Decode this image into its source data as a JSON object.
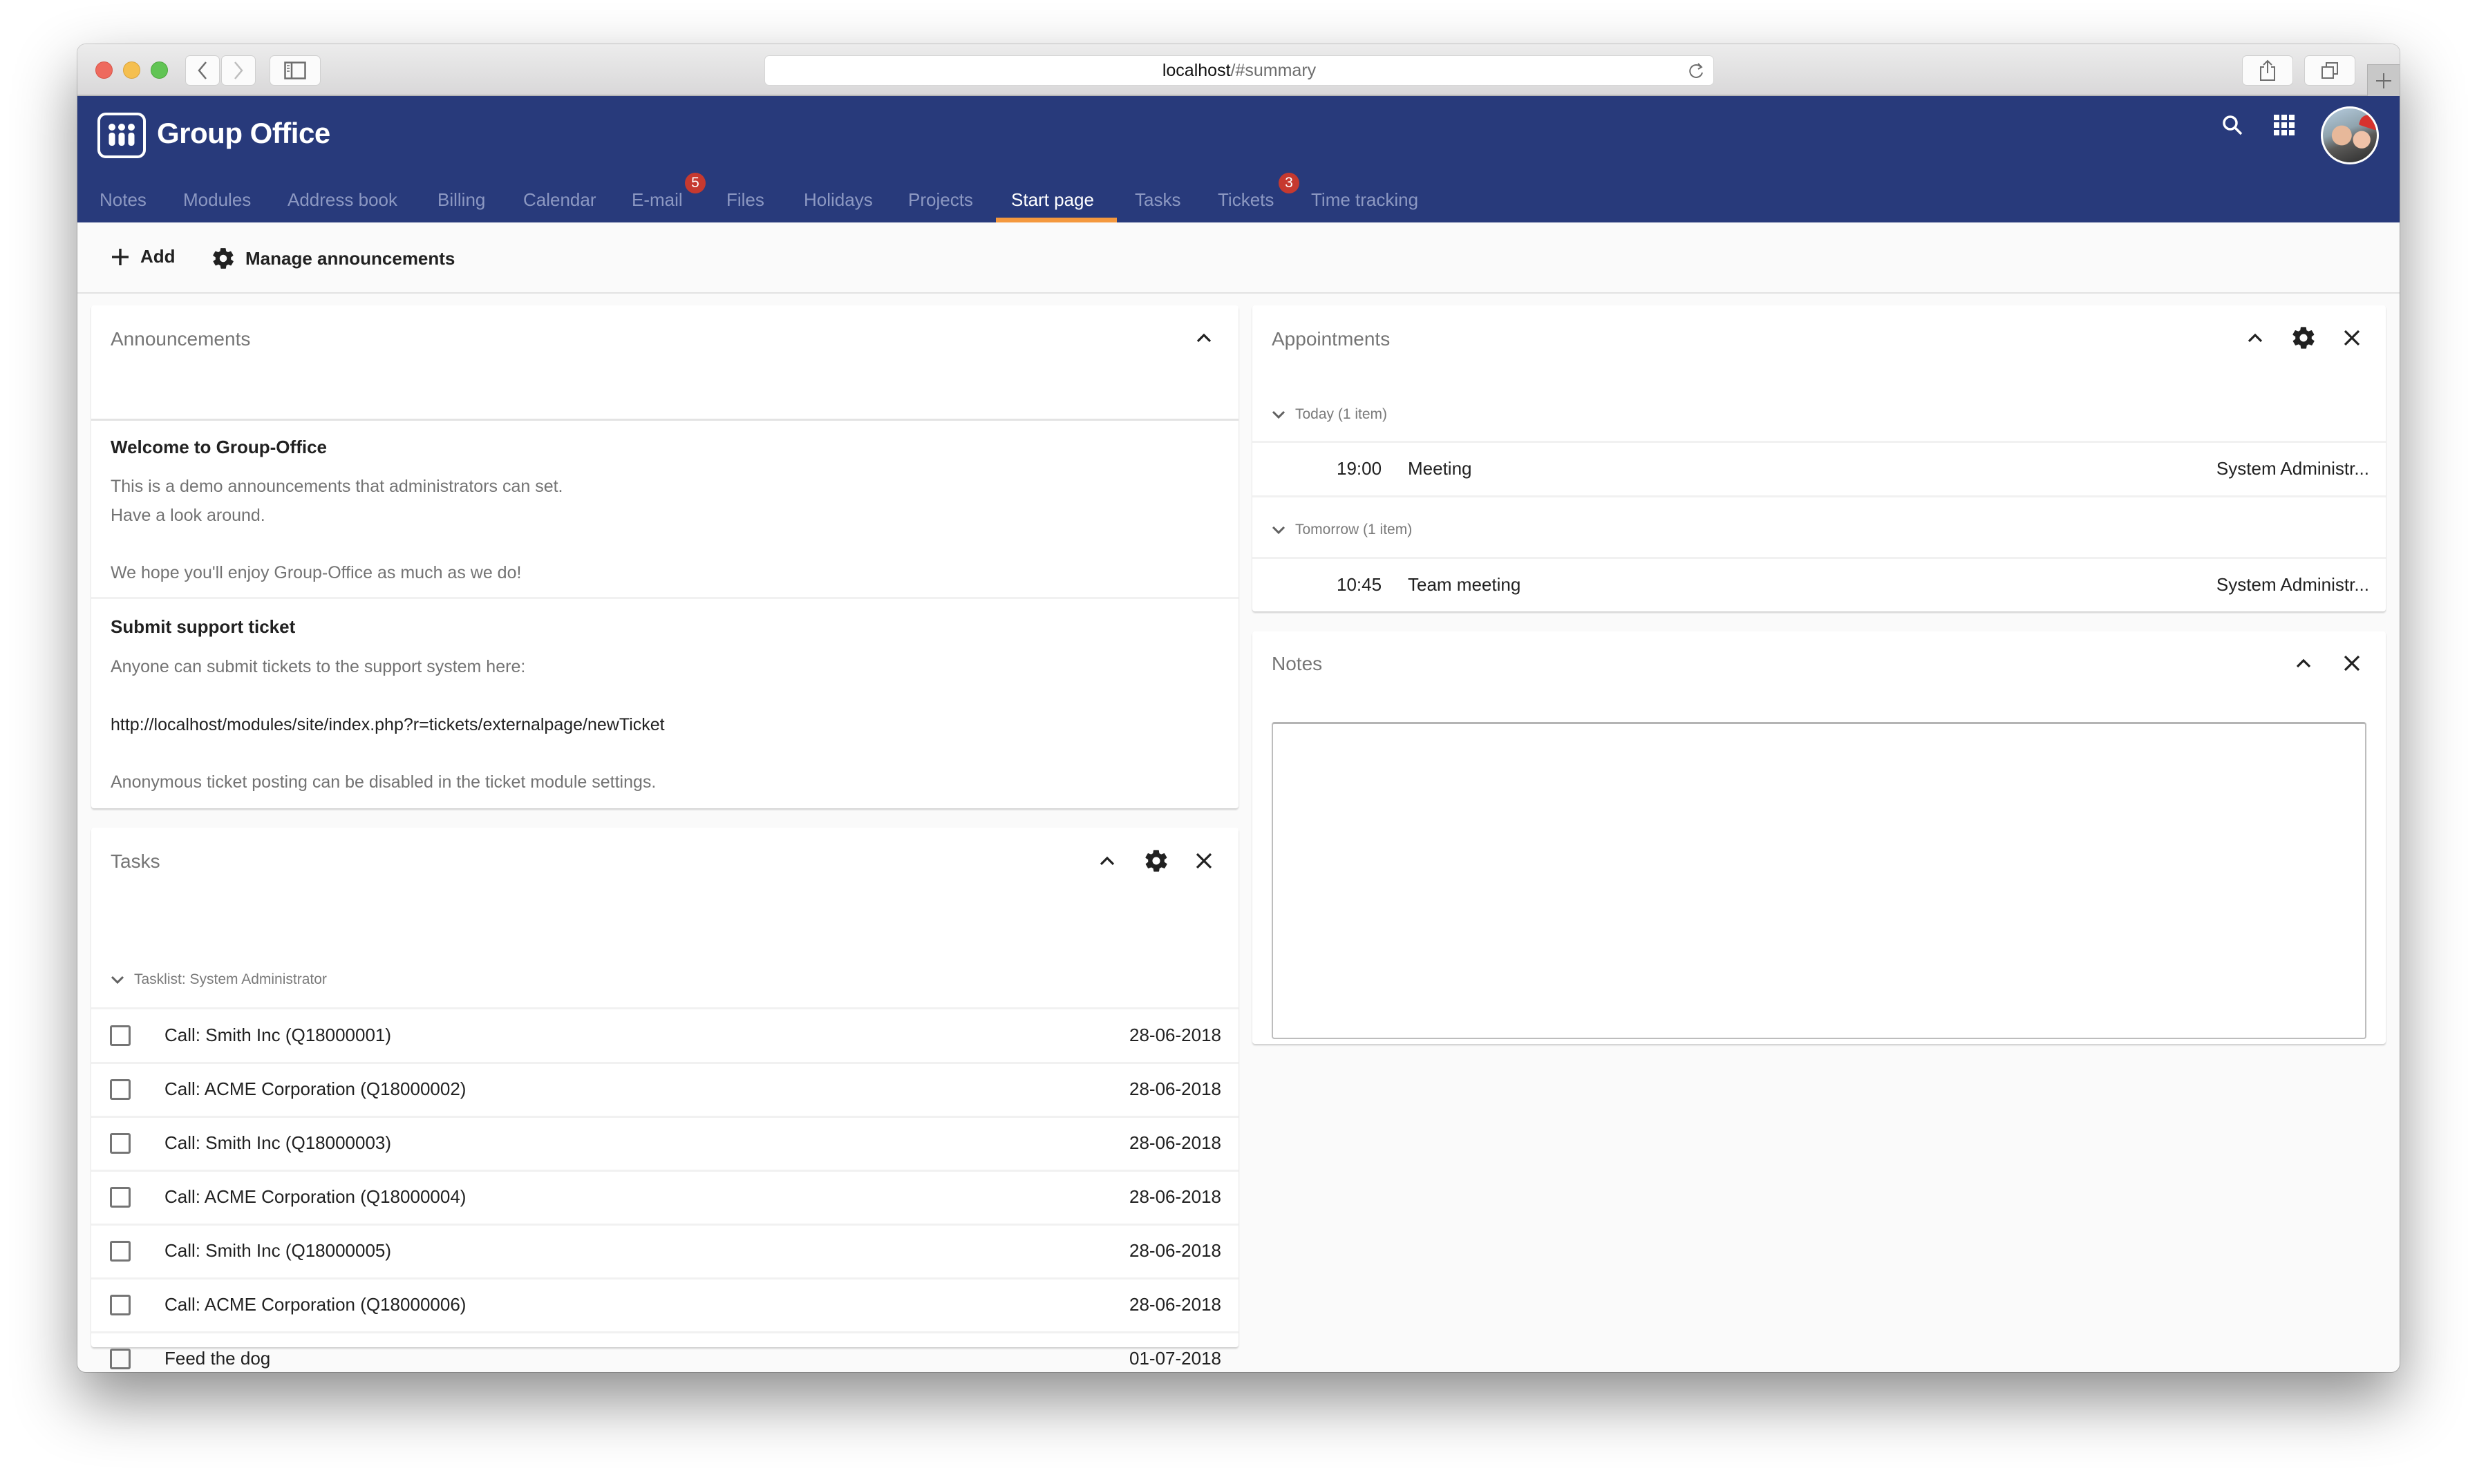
{
  "browser": {
    "url_host": "localhost",
    "url_path": "/#summary",
    "icons": [
      "back-icon",
      "forward-icon",
      "sidebar-icon",
      "reload-icon",
      "share-icon",
      "tabs-icon",
      "new-tab-icon"
    ]
  },
  "header": {
    "app_name": "Group Office",
    "brand_color": "#283a7b",
    "accent_color": "#f4983e",
    "badge_color": "#c6392f",
    "icons": [
      "search-icon",
      "apps-grid-icon",
      "avatar"
    ],
    "tabs": [
      {
        "label": "Notes"
      },
      {
        "label": "Modules"
      },
      {
        "label": "Address book"
      },
      {
        "label": "Billing"
      },
      {
        "label": "Calendar"
      },
      {
        "label": "E-mail",
        "badge": "5"
      },
      {
        "label": "Files"
      },
      {
        "label": "Holidays"
      },
      {
        "label": "Projects"
      },
      {
        "label": "Start page",
        "active": true
      },
      {
        "label": "Tasks"
      },
      {
        "label": "Tickets",
        "badge": "3"
      },
      {
        "label": "Time tracking"
      }
    ]
  },
  "toolbar": {
    "add_label": "Add",
    "manage_label": "Manage announcements"
  },
  "announcements": {
    "title": "Announcements",
    "items": [
      {
        "heading": "Welcome to Group-Office",
        "lines": [
          "This is a demo announcements that administrators can set.",
          "Have a look around.",
          "We hope you'll enjoy Group-Office as much as we do!"
        ]
      },
      {
        "heading": "Submit support ticket",
        "lines": [
          "Anyone can submit tickets to the support system here:",
          "http://localhost/modules/site/index.php?r=tickets/externalpage/newTicket",
          "Anonymous ticket posting can be disabled in the ticket module settings."
        ]
      }
    ]
  },
  "tasks": {
    "title": "Tasks",
    "group": "Tasklist: System Administrator",
    "rows": [
      {
        "title": "Call: Smith Inc (Q18000001)",
        "date": "28-06-2018",
        "done": false
      },
      {
        "title": "Call: ACME Corporation (Q18000002)",
        "date": "28-06-2018",
        "done": false
      },
      {
        "title": "Call: Smith Inc (Q18000003)",
        "date": "28-06-2018",
        "done": false
      },
      {
        "title": "Call: ACME Corporation (Q18000004)",
        "date": "28-06-2018",
        "done": false
      },
      {
        "title": "Call: Smith Inc (Q18000005)",
        "date": "28-06-2018",
        "done": false
      },
      {
        "title": "Call: ACME Corporation (Q18000006)",
        "date": "28-06-2018",
        "done": false
      },
      {
        "title": "Feed the dog",
        "date": "01-07-2018",
        "done": false
      }
    ]
  },
  "appointments": {
    "title": "Appointments",
    "groups": [
      {
        "label": "Today (1 item)",
        "rows": [
          {
            "time": "19:00",
            "title": "Meeting",
            "owner": "System Administr..."
          }
        ]
      },
      {
        "label": "Tomorrow (1 item)",
        "rows": [
          {
            "time": "10:45",
            "title": "Team meeting",
            "owner": "System Administr..."
          }
        ]
      }
    ]
  },
  "notes": {
    "title": "Notes",
    "value": "",
    "placeholder": ""
  }
}
